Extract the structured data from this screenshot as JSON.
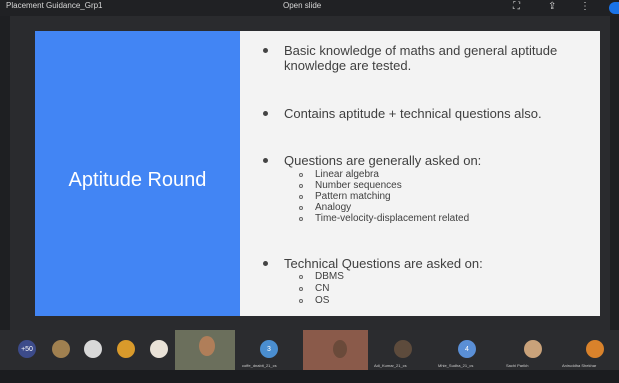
{
  "window": {
    "title": "Placement Guidance_Grp1",
    "presenting": "Open slide",
    "icons": [
      "fullscreen-icon",
      "share-icon",
      "more-icon"
    ]
  },
  "slide": {
    "heading": "Aptitude Round",
    "bullets": [
      {
        "text": "Basic knowledge of maths and general aptitude knowledge are tested."
      },
      {
        "text": "Contains aptitude + technical questions also."
      },
      {
        "text": "Questions are generally asked on:",
        "subitems": [
          "Linear algebra",
          "Number sequences",
          "Pattern matching",
          "Analogy",
          "Time-velocity-displacement related"
        ]
      },
      {
        "text": "Technical Questions are asked on:",
        "subitems": [
          "DBMS",
          "CN",
          "OS"
        ]
      }
    ],
    "colors": {
      "accent": "#4285f4",
      "slide_bg": "#f3f3f3"
    }
  },
  "participants": {
    "overflow_count": "+50",
    "tiles": [
      {
        "initial": "3",
        "caption": "coffe_dnabit_21_cs",
        "color": "#4a8ed0"
      },
      {
        "initial": "4",
        "caption": "Mhie_Sudha_21_cs",
        "color": "#5a8fd6"
      }
    ],
    "captions": [
      "Adi_Kumar_21_cs",
      "Sachi Parikh",
      "Aniruddha Shekhar"
    ]
  }
}
